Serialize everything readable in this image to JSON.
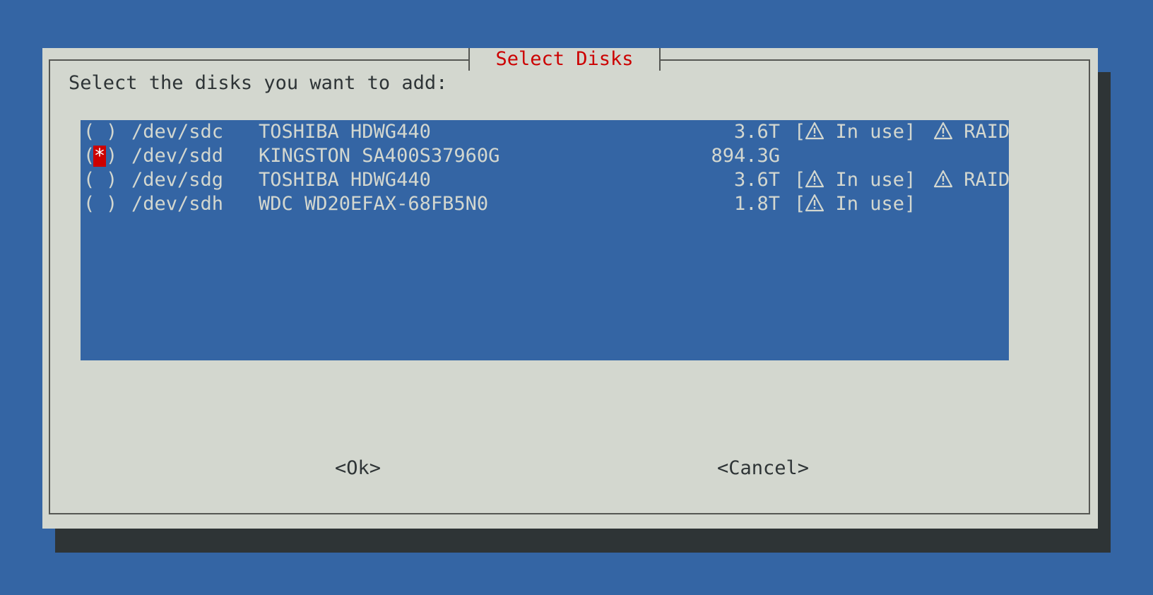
{
  "dialog": {
    "title": "Select Disks",
    "prompt": "Select the disks you want to add:"
  },
  "disks": [
    {
      "mark": " ",
      "device": "/dev/sdc",
      "model": "TOSHIBA HDWG440",
      "size": "3.6T",
      "in_use": "In use",
      "raid": "RAID"
    },
    {
      "mark": "*",
      "device": "/dev/sdd",
      "model": "KINGSTON SA400S37960G",
      "size": "894.3G",
      "in_use": "",
      "raid": ""
    },
    {
      "mark": " ",
      "device": "/dev/sdg",
      "model": "TOSHIBA HDWG440",
      "size": "3.6T",
      "in_use": "In use",
      "raid": "RAID"
    },
    {
      "mark": " ",
      "device": "/dev/sdh",
      "model": "WDC WD20EFAX-68FB5N0",
      "size": "1.8T",
      "in_use": "In use",
      "raid": ""
    }
  ],
  "buttons": {
    "ok": "<Ok>",
    "cancel": "<Cancel>"
  },
  "icons": {
    "warning": "warning-triangle-icon"
  },
  "colors": {
    "background": "#3465a4",
    "dialog": "#d3d7cf",
    "title": "#cc0000",
    "selected_mark": "#cc0000",
    "shadow": "#2e3436"
  }
}
